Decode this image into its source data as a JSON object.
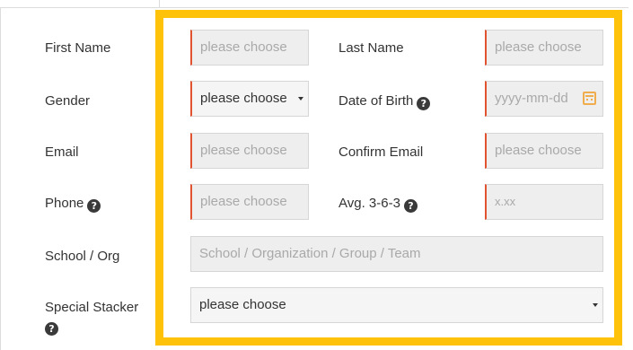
{
  "form": {
    "first_name_label": "First Name",
    "first_name_placeholder": "please choose",
    "last_name_label": "Last Name",
    "last_name_placeholder": "please choose",
    "gender_label": "Gender",
    "gender_value": "please choose",
    "dob_label": "Date of Birth",
    "dob_placeholder": "yyyy-mm-dd",
    "email_label": "Email",
    "email_placeholder": "please choose",
    "confirm_email_label": "Confirm Email",
    "confirm_email_placeholder": "please choose",
    "phone_label": "Phone",
    "phone_placeholder": "please choose",
    "avg_label": "Avg. 3-6-3",
    "avg_placeholder": "x.xx",
    "school_label": "School / Org",
    "school_placeholder": "School / Organization / Group / Team",
    "special_stacker_label": "Special Stacker",
    "special_stacker_value": "please choose",
    "help_glyph": "?"
  },
  "colors": {
    "highlight": "#ffc20a",
    "required_accent": "#e0532e",
    "calendar_icon": "#f0ad4e"
  }
}
